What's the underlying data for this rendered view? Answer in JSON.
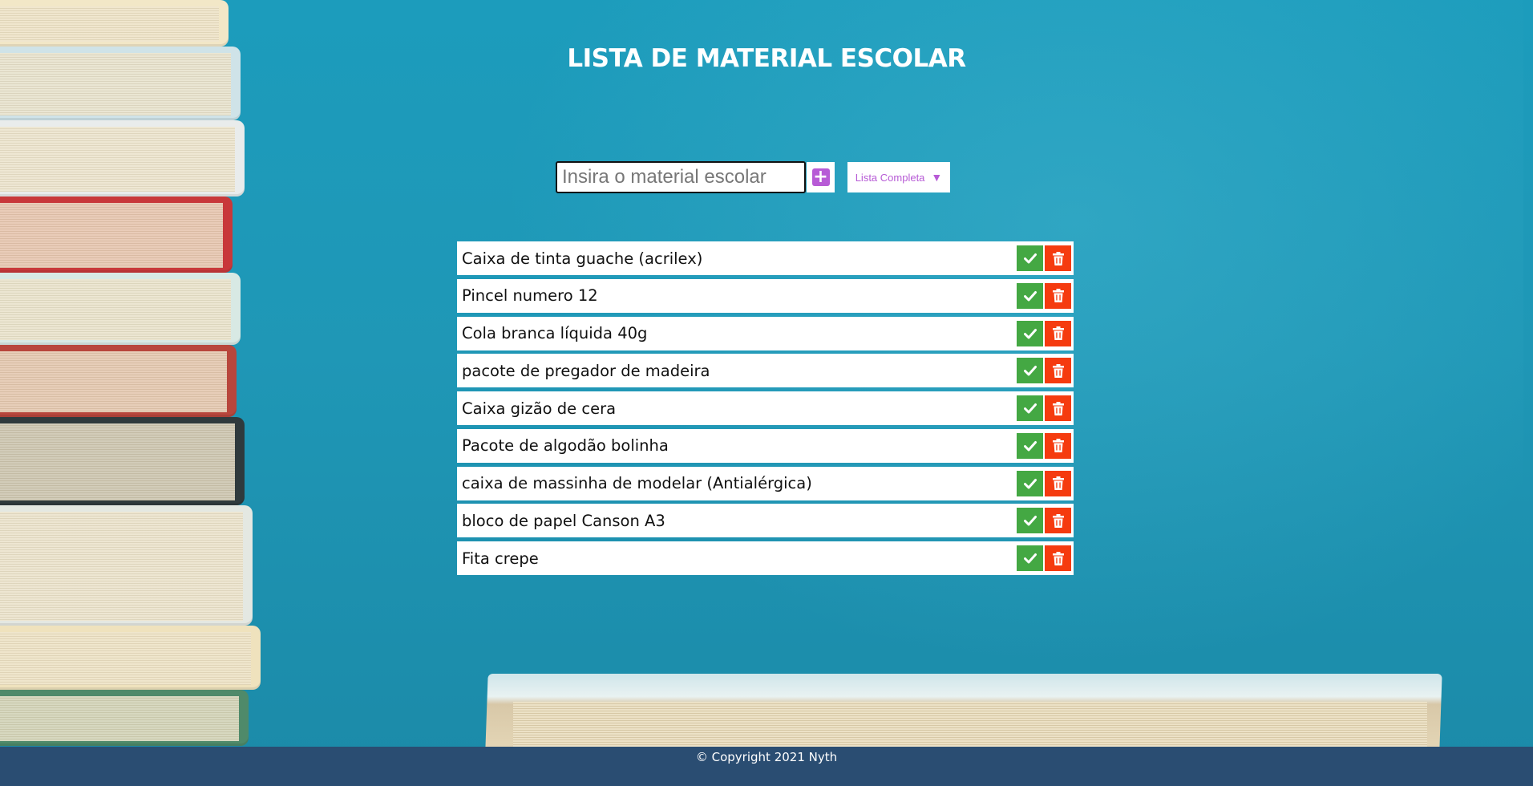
{
  "header": {
    "title": "LISTA DE MATERIAL ESCOLAR"
  },
  "form": {
    "input_placeholder": "Insira o material escolar",
    "input_value": "",
    "add_icon": "plus-square-icon",
    "filter_selected": "Lista Completa",
    "filter_icon": "caret-down-icon"
  },
  "items": [
    {
      "label": "Caixa de tinta guache (acrilex)"
    },
    {
      "label": "Pincel numero 12"
    },
    {
      "label": "Cola branca líquida 40g"
    },
    {
      "label": "pacote de pregador de madeira"
    },
    {
      "label": "Caixa gizão de cera"
    },
    {
      "label": "Pacote de algodão bolinha"
    },
    {
      "label": "caixa de massinha de modelar (Antialérgica)"
    },
    {
      "label": "bloco de papel Canson A3"
    },
    {
      "label": "Fita crepe"
    }
  ],
  "item_actions": {
    "complete_icon": "check-icon",
    "delete_icon": "trash-icon"
  },
  "footer": {
    "text": "© Copyright 2021 Nyth"
  },
  "colors": {
    "background": "#1c9cbc",
    "accent": "#b75bd6",
    "complete": "#44a843",
    "delete": "#f53b0f",
    "footer": "#2a4d72"
  }
}
